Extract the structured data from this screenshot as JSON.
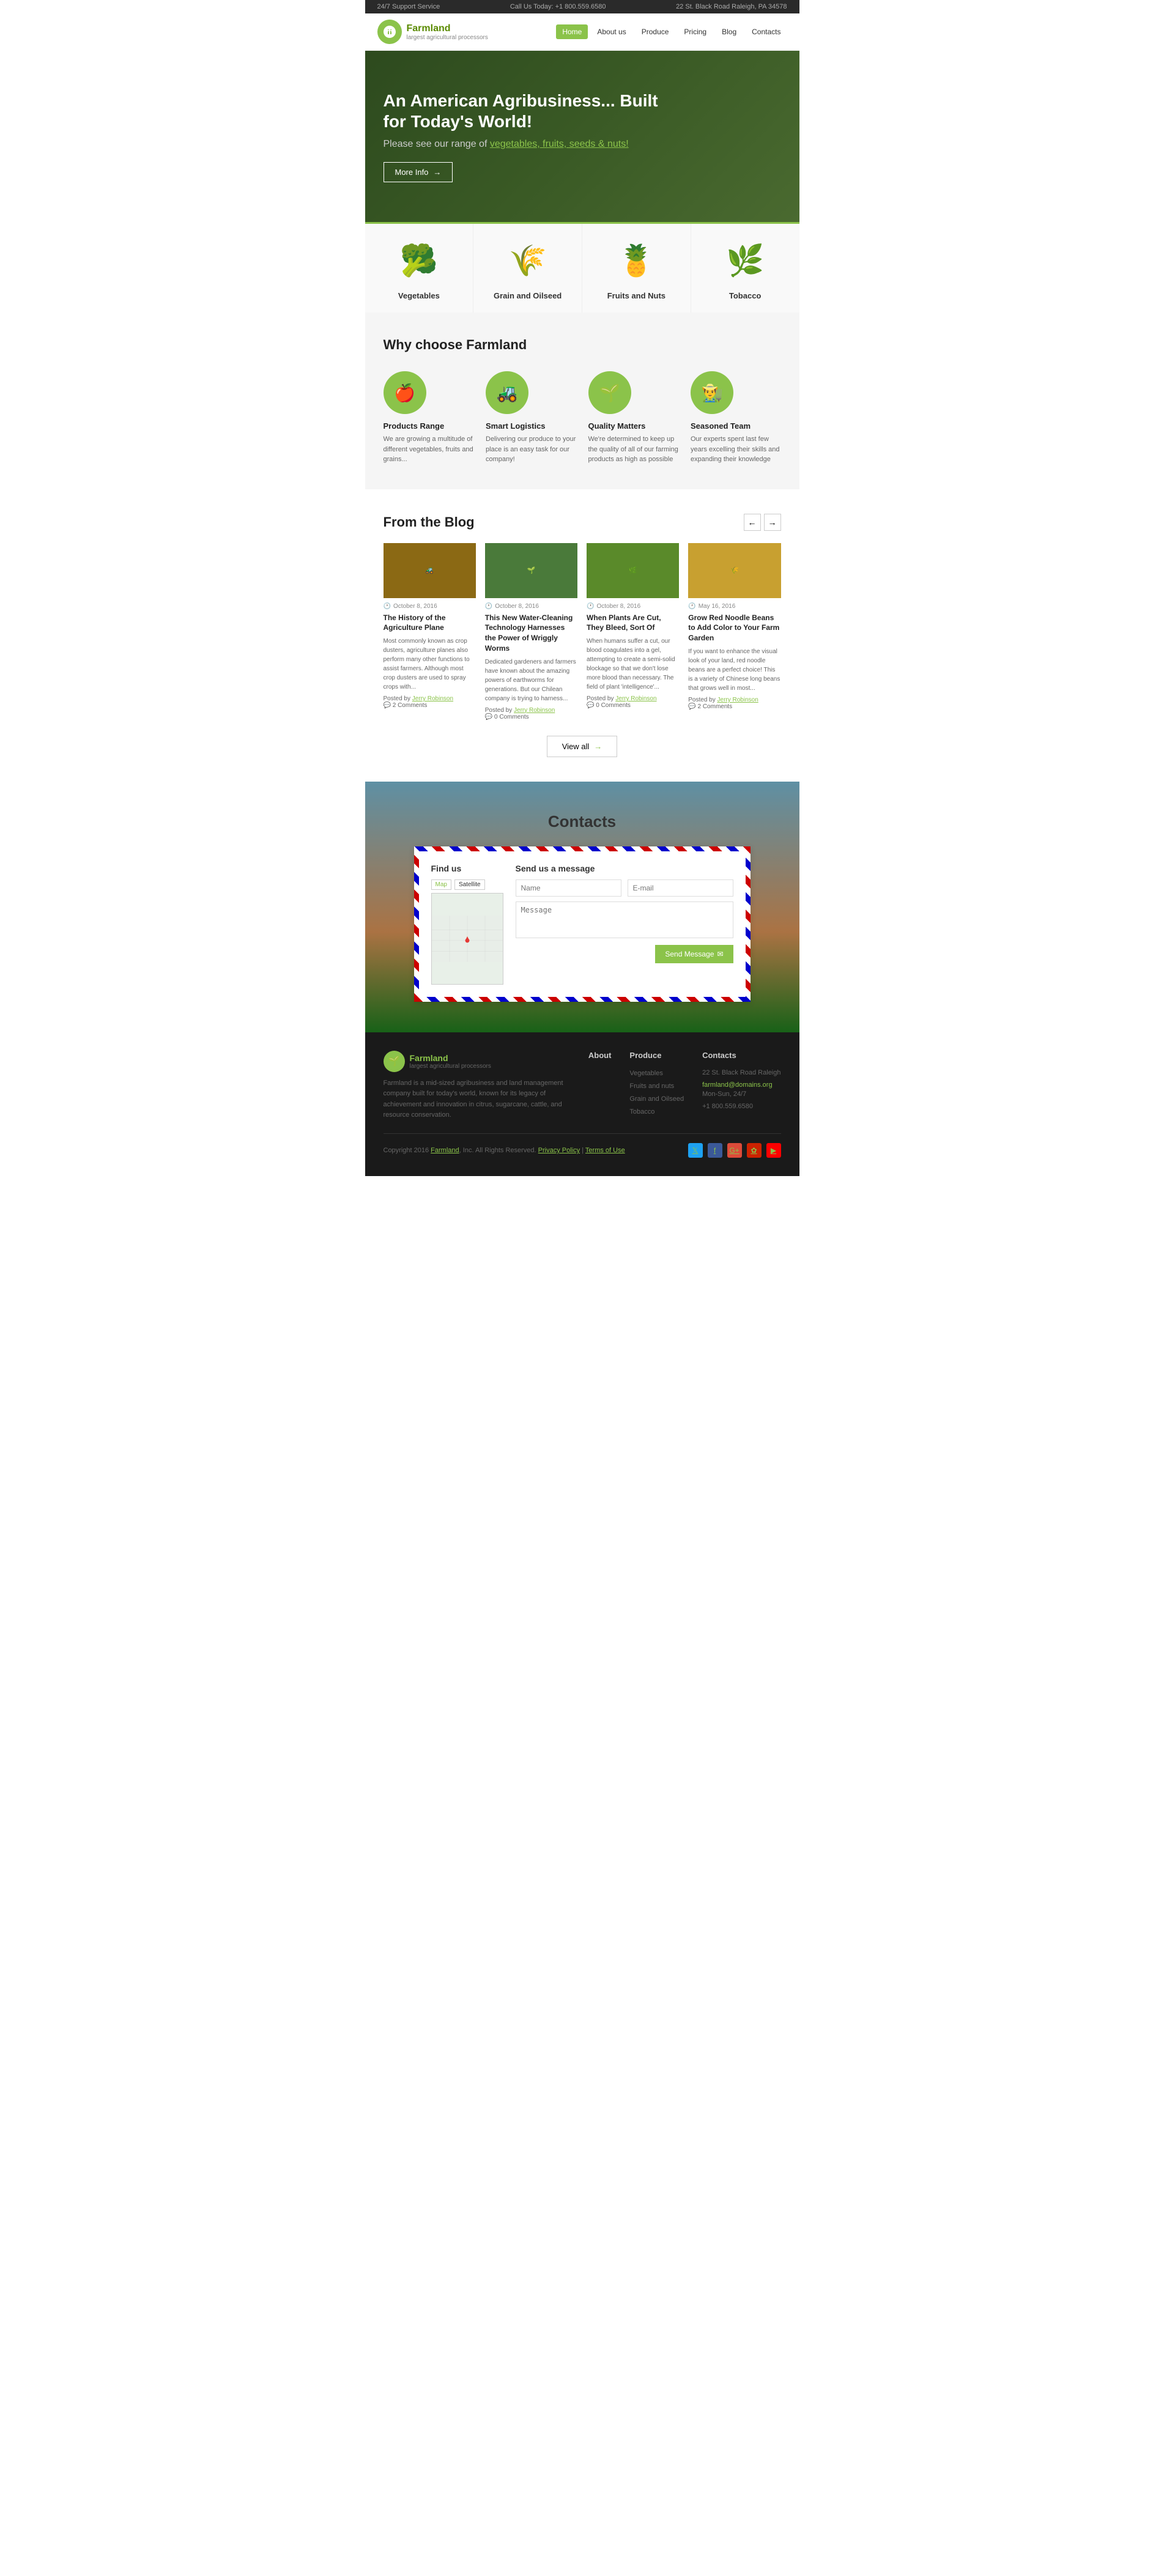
{
  "topbar": {
    "support": "24/7 Support Service",
    "phone_label": "Call Us Today: +1 800.559.6580",
    "address": "22 St. Black Road Raleigh, PA 34578"
  },
  "header": {
    "logo_name": "Farmland",
    "logo_tagline": "largest agricultural processors",
    "nav": [
      {
        "label": "Home",
        "active": true
      },
      {
        "label": "About us",
        "active": false
      },
      {
        "label": "Produce",
        "active": false
      },
      {
        "label": "Pricing",
        "active": false
      },
      {
        "label": "Blog",
        "active": false
      },
      {
        "label": "Contacts",
        "active": false
      }
    ]
  },
  "hero": {
    "title": "An American Agribusiness... Built for Today's World!",
    "subtitle_plain": "Please see our range of ",
    "subtitle_link": "vegetables, fruits, seeds & nuts!",
    "btn_label": "More Info"
  },
  "categories": [
    {
      "name": "Vegetables",
      "icon": "🥦"
    },
    {
      "name": "Grain and Oilseed",
      "icon": "🌾"
    },
    {
      "name": "Fruits and Nuts",
      "icon": "🍍"
    },
    {
      "name": "Tobacco",
      "icon": "🌿"
    }
  ],
  "why_section": {
    "title": "Why choose Farmland",
    "items": [
      {
        "icon": "🍎",
        "title": "Products Range",
        "desc": "We are growing a multitude of different vegetables, fruits and grains..."
      },
      {
        "icon": "🚜",
        "title": "Smart Logistics",
        "desc": "Delivering our produce to your place is an easy task for our company!"
      },
      {
        "icon": "🌱",
        "title": "Quality Matters",
        "desc": "We're determined to keep up the quality of all of our farming products as high as possible"
      },
      {
        "icon": "👨‍🌾",
        "title": "Seasoned Team",
        "desc": "Our experts spent last few years excelling their skills and expanding their knowledge"
      }
    ]
  },
  "blog_section": {
    "title": "From the Blog",
    "posts": [
      {
        "date": "October 8, 2016",
        "title": "The History of the Agriculture Plane",
        "excerpt": "Most commonly known as crop dusters, agriculture planes also perform many other functions to assist farmers. Although most crop dusters are used to spray crops with...",
        "author": "Jerry Robinson",
        "comments": "2 Comments",
        "bg": "#8b6914"
      },
      {
        "date": "October 8, 2016",
        "title": "This New Water-Cleaning Technology Harnesses the Power of Wriggly Worms",
        "excerpt": "Dedicated gardeners and farmers have known about the amazing powers of earthworms for generations. But our Chilean company is trying to harness...",
        "author": "Jerry Robinson",
        "comments": "0 Comments",
        "bg": "#4a7a3a"
      },
      {
        "date": "October 8, 2016",
        "title": "When Plants Are Cut, They Bleed, Sort Of",
        "excerpt": "When humans suffer a cut, our blood coagulates into a gel, attempting to create a semi-solid blockage so that we don't lose more blood than necessary. The field of plant 'intelligence'...",
        "author": "Jerry Robinson",
        "comments": "0 Comments",
        "bg": "#5a8a2a"
      },
      {
        "date": "May 16, 2016",
        "title": "Grow Red Noodle Beans to Add Color to Your Farm Garden",
        "excerpt": "If you want to enhance the visual look of your land, red noodle beans are a perfect choice! This is a variety of Chinese long beans that grows well in most...",
        "author": "Jerry Robinson",
        "comments": "2 Comments",
        "bg": "#c8a030"
      }
    ],
    "view_all": "View all"
  },
  "contacts_section": {
    "title": "Contacts",
    "find_us": "Find us",
    "map_tabs": [
      "Map",
      "Satellite"
    ],
    "send_message": "Send us a message",
    "name_placeholder": "Name",
    "email_placeholder": "E-mail",
    "message_placeholder": "Message",
    "send_btn": "Send Message"
  },
  "footer": {
    "logo_name": "Farmland",
    "logo_tagline": "largest agricultural processors",
    "desc": "Farmland is a mid-sized agribusiness and land management company built for today's world, known for its legacy of achievement and innovation in citrus, sugarcane, cattle, and resource conservation.",
    "about_title": "About",
    "produce_title": "Produce",
    "contacts_title": "Contacts",
    "produce_items": [
      "Vegetables",
      "Fruits and nuts",
      "Grain and Oilseed",
      "Tobacco"
    ],
    "contact_address": "22 St. Black Road Raleigh",
    "contact_email": "farmland@domains.org",
    "contact_hours": "Mon-Sun, 24/7",
    "contact_phone": "+1 800.559.6580",
    "copyright": "Copyright 2016",
    "brand": "Farmland",
    "rights": "Inc. All Rights Reserved.",
    "privacy": "Privacy Policy",
    "terms": "Terms of Use",
    "social_icons": [
      "𝕏",
      "f",
      "G+",
      "in",
      "▶"
    ]
  }
}
